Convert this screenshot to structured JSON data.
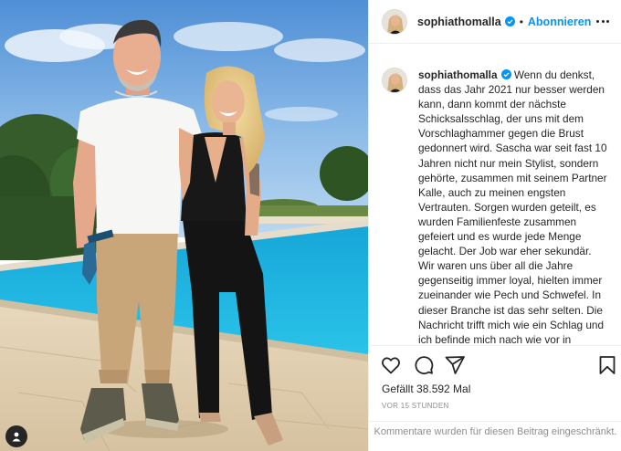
{
  "post": {
    "username": "sophiathomalla",
    "separator": "•",
    "follow_label": "Abonnieren",
    "caption": "Wenn du denkst, dass das Jahr 2021 nur besser werden kann, dann kommt der nächste Schicksalsschlag, der uns mit dem Vorschlaghammer gegen die Brust gedonnert wird. Sascha war seit fast 10 Jahren nicht nur mein Stylist, sondern gehörte, zusammen mit seinem Partner Kalle, auch zu meinen engsten Vertrauten. Sorgen wurden geteilt, es wurden Familienfeste zusammen gefeiert und es wurde jede Menge gelacht. Der Job war eher sekundär. Wir waren uns über all die Jahre gegenseitig immer loyal, hielten immer zueinander wie Pech und Schwefel. In dieser Branche ist das sehr selten. Die Nachricht trifft mich wie ein Schlag und ich befinde mich nach wie vor in Schockstarre. Ich bin",
    "likes": "Gefällt 38.592 Mal",
    "timestamp": "VOR 15 STUNDEN",
    "comments_disabled": "Kommentare wurden für diesen Beitrag eingeschränkt."
  },
  "icons": {
    "verified": "verified-badge-icon",
    "more": "more-options-icon",
    "like": "heart-icon",
    "comment": "comment-icon",
    "share": "share-icon",
    "save": "bookmark-icon",
    "tag": "user-tag-icon"
  },
  "colors": {
    "accent": "#0095f6",
    "text": "#262626",
    "muted": "#8e8e8e",
    "border": "#efefef"
  }
}
